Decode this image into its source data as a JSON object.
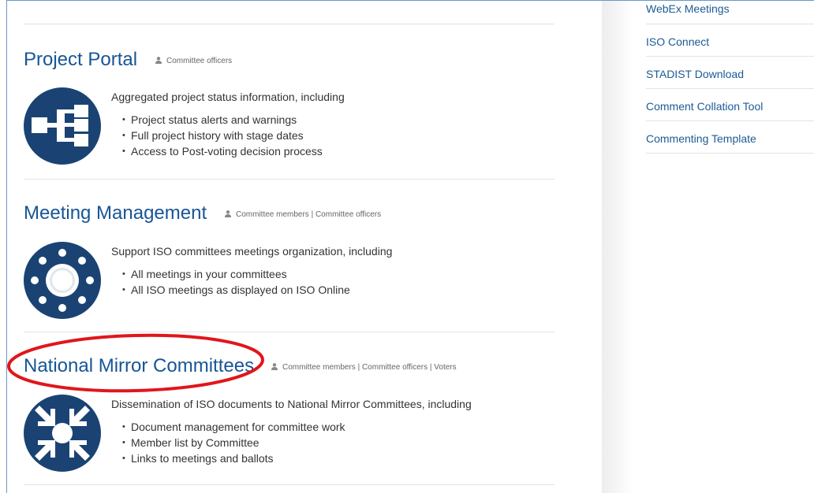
{
  "sections": [
    {
      "title": "Project Portal",
      "roles": "Committee officers",
      "icon": "hierarchy-icon",
      "lead": "Aggregated project status information, including",
      "bullets": [
        "Project status alerts and warnings",
        "Full project history with stage dates",
        "Access to Post-voting decision process"
      ]
    },
    {
      "title": "Meeting Management",
      "roles": "Committee members | Committee officers",
      "icon": "meeting-circle-icon",
      "lead": "Support ISO committees meetings organization, including",
      "bullets": [
        "All meetings in your committees",
        "All ISO meetings as displayed on ISO Online"
      ]
    },
    {
      "title": "National Mirror Committees",
      "roles": "Committee members | Committee officers | Voters",
      "icon": "converge-arrows-icon",
      "lead": "Dissemination of ISO documents to National Mirror Committees, including",
      "bullets": [
        "Document management for committee work",
        "Member list by Committee",
        "Links to meetings and ballots"
      ]
    }
  ],
  "sidebar": {
    "items": [
      "WebEx Meetings",
      "ISO Connect",
      "STADIST Download",
      "Comment Collation Tool",
      "Commenting Template"
    ]
  },
  "colors": {
    "title": "#175596",
    "icon_bg": "#1a4373",
    "link": "#1c5b95",
    "annotation": "#e0161b"
  }
}
